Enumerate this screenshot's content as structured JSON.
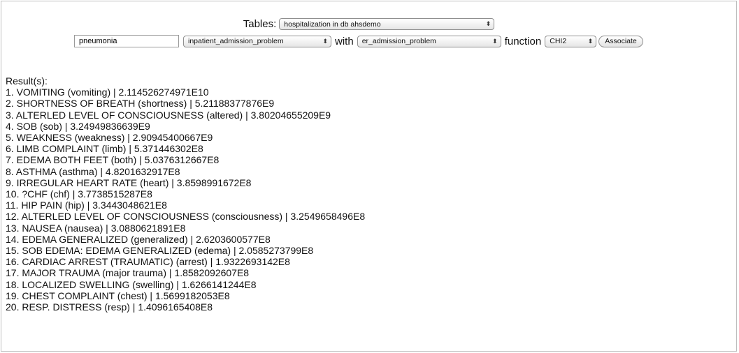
{
  "form": {
    "tables_label": "Tables:",
    "table_select": "hospitalization in db ahsdemo",
    "search_value": "pneumonia",
    "field1_select": "inpatient_admission_problem",
    "with_label": "with",
    "field2_select": "er_admission_problem",
    "function_label": "function",
    "function_select": "CHI2",
    "associate_button": "Associate"
  },
  "results": {
    "heading": "Result(s):",
    "items": [
      "1. VOMITING (vomiting) | 2.114526274971E10",
      "2. SHORTNESS OF BREATH (shortness) | 5.21188377876E9",
      "3. ALTERLED LEVEL OF CONSCIOUSNESS (altered) | 3.80204655209E9",
      "4. SOB (sob) | 3.24949836639E9",
      "5. WEAKNESS (weakness) | 2.90945400667E9",
      "6. LIMB COMPLAINT (limb) | 5.371446302E8",
      "7. EDEMA BOTH FEET (both) | 5.0376312667E8",
      "8. ASTHMA (asthma) | 4.8201632917E8",
      "9. IRREGULAR HEART RATE (heart) | 3.8598991672E8",
      "10. ?CHF (chf) | 3.7738515287E8",
      "11. HIP PAIN (hip) | 3.3443048621E8",
      "12. ALTERLED LEVEL OF CONSCIOUSNESS (consciousness) | 3.2549658496E8",
      "13. NAUSEA (nausea) | 3.0880621891E8",
      "14. EDEMA GENERALIZED (generalized) | 2.6203600577E8",
      "15. SOB EDEMA: EDEMA GENERALIZED (edema) | 2.0585273799E8",
      "16. CARDIAC ARREST (TRAUMATIC) (arrest) | 1.9322693142E8",
      "17. MAJOR TRAUMA (major trauma) | 1.8582092607E8",
      "18. LOCALIZED SWELLING (swelling) | 1.6266141244E8",
      "19. CHEST COMPLAINT (chest) | 1.5699182053E8",
      "20. RESP. DISTRESS (resp) | 1.4096165408E8"
    ]
  }
}
